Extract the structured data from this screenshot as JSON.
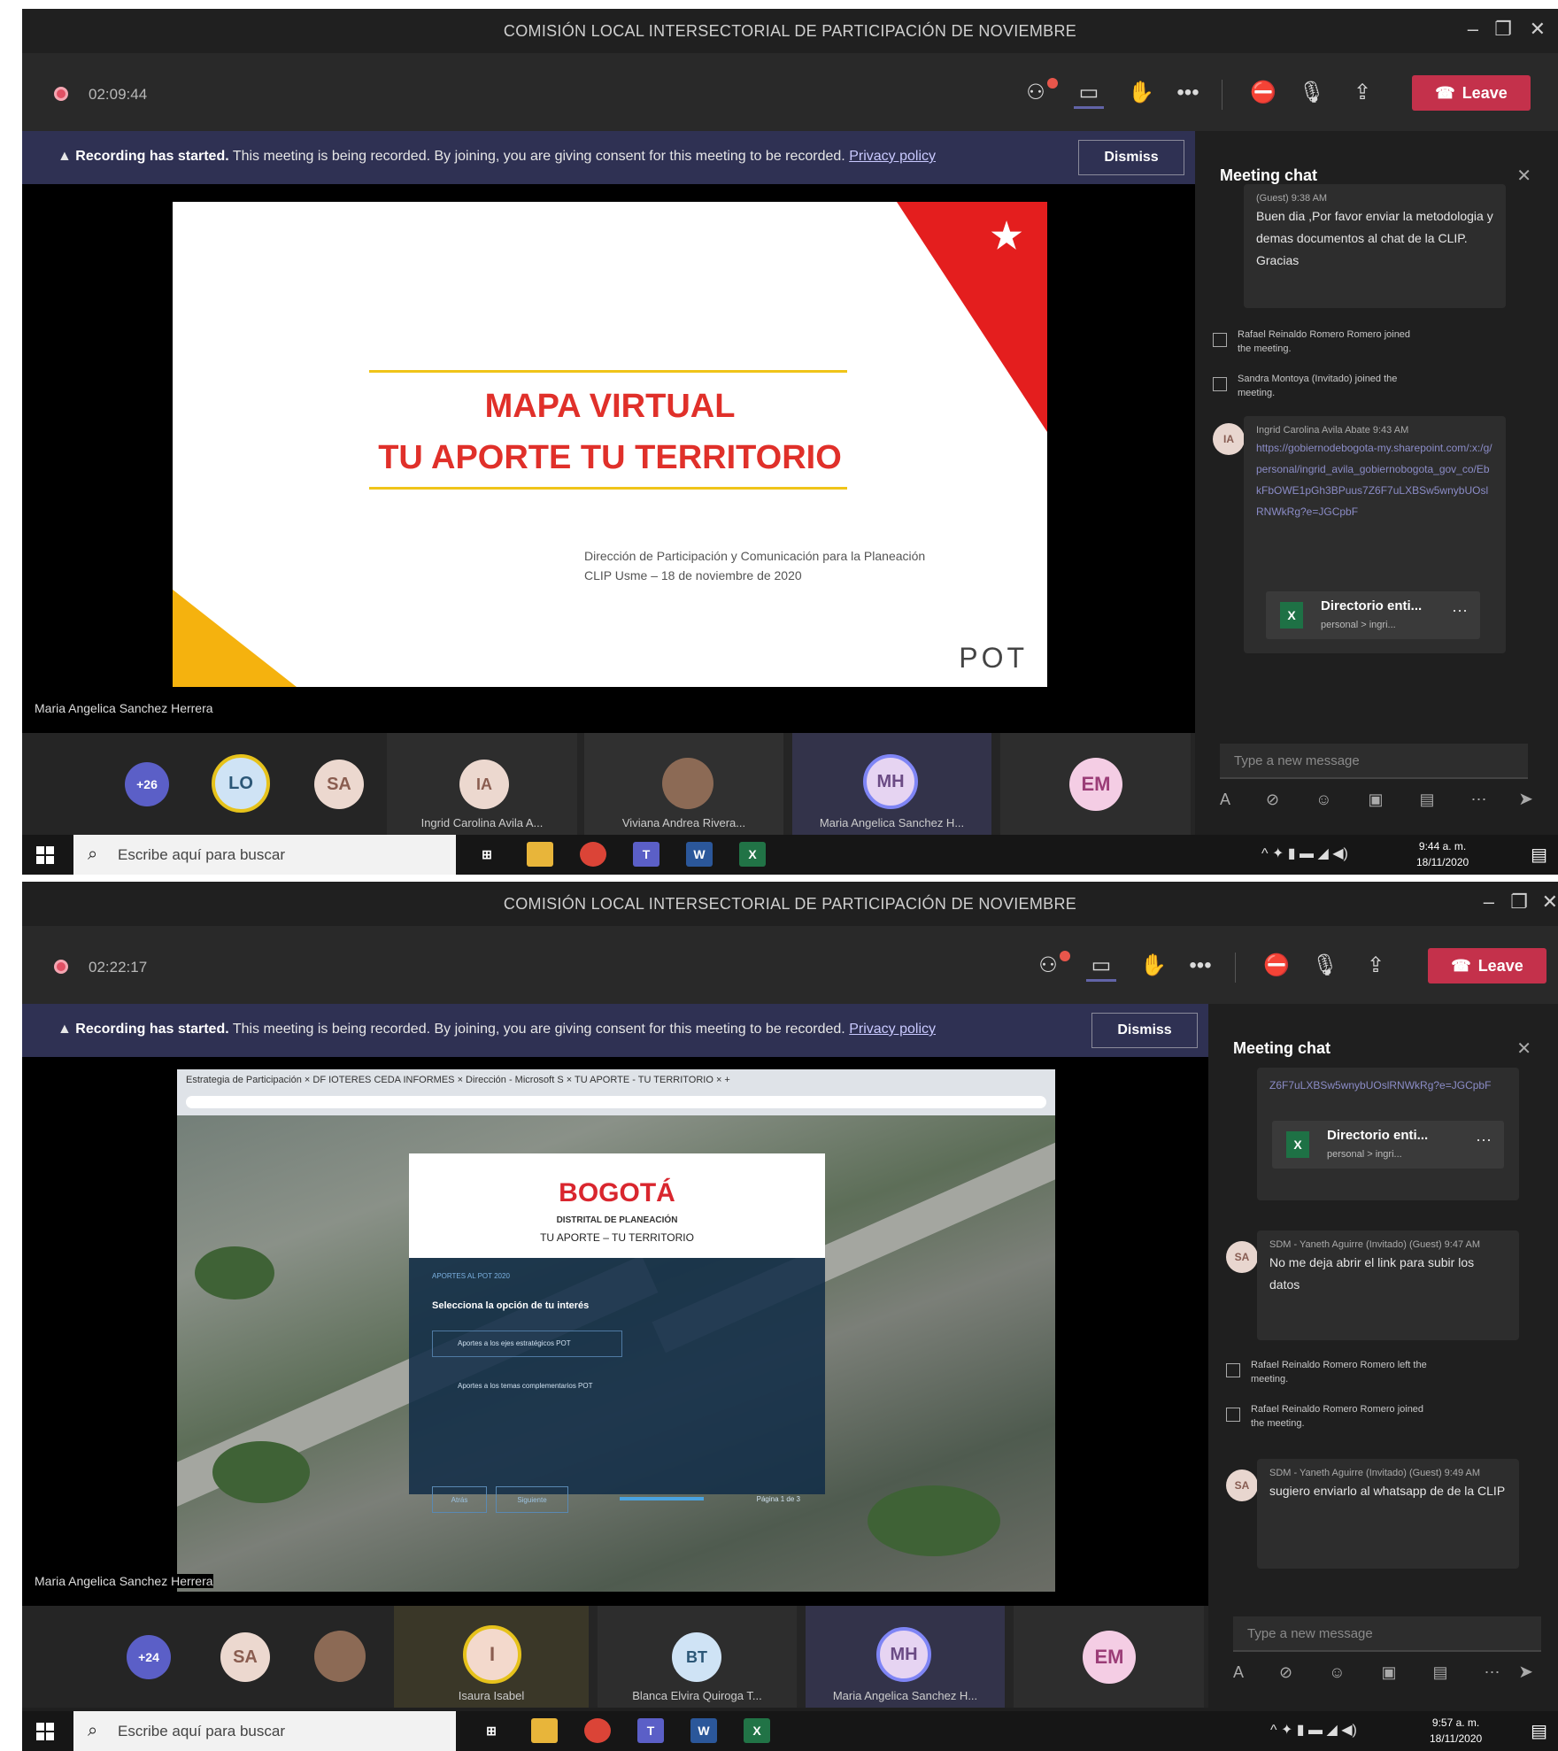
{
  "screens": [
    {
      "window_title": "COMISIÓN LOCAL INTERSECTORIAL DE PARTICIPACIÓN DE NOVIEMBRE",
      "timer": "02:09:44",
      "leave_label": "Leave",
      "banner": {
        "title": "Recording has started.",
        "text": "This meeting is being recorded. By joining, you are giving consent for this meeting to be recorded.",
        "link": "Privacy policy",
        "dismiss": "Dismiss"
      },
      "presenter": "Maria Angelica Sanchez Herrera",
      "slide": {
        "title1": "MAPA VIRTUAL",
        "title2": "TU APORTE TU TERRITORIO",
        "sub1": "Dirección de Participación y Comunicación para la Planeación",
        "sub2": "CLIP Usme – 18 de noviembre de 2020",
        "brand": "POT"
      },
      "participants": [
        {
          "initials": "+26",
          "name": ""
        },
        {
          "initials": "LO",
          "name": ""
        },
        {
          "initials": "SA",
          "name": ""
        },
        {
          "initials": "IA",
          "name": "Ingrid Carolina Avila A..."
        },
        {
          "initials": "",
          "name": "Viviana Andrea Rivera..."
        },
        {
          "initials": "MH",
          "name": "Maria Angelica Sanchez H..."
        },
        {
          "initials": "EM",
          "name": ""
        }
      ],
      "chat": {
        "header": "Meeting chat",
        "messages": [
          {
            "meta": "(Guest)  9:38 AM",
            "text": "Buen dia ,Por favor enviar la metodologia y demas documentos al chat de la CLIP. Gracias"
          },
          {
            "system": "Rafael Reinaldo Romero Romero joined the meeting."
          },
          {
            "system": "Sandra Montoya (Invitado) joined the meeting."
          },
          {
            "avatar": "IA",
            "meta": "Ingrid Carolina Avila Abate  9:43 AM",
            "link": "https://gobiernodebogota-my.sharepoint.com/:x:/g/personal/ingrid_avila_gobiernobogota_gov_co/EbkFbOWE1pGh3BPuus7Z6F7uLXBSw5wnybUOslRNWkRg?e=JGCpbF"
          }
        ],
        "file": {
          "name": "Directorio enti...",
          "path": "personal > ingri..."
        },
        "compose_placeholder": "Type a new message"
      },
      "taskbar": {
        "search": "Escribe aquí para buscar",
        "time": "9:44 a. m.",
        "date": "18/11/2020"
      }
    },
    {
      "window_title": "COMISIÓN LOCAL INTERSECTORIAL DE PARTICIPACIÓN DE NOVIEMBRE",
      "timer": "02:22:17",
      "leave_label": "Leave",
      "banner": {
        "title": "Recording has started.",
        "text": "This meeting is being recorded. By joining, you are giving consent for this meeting to be recorded.",
        "link": "Privacy policy",
        "dismiss": "Dismiss"
      },
      "presenter": "Maria Angelica Sanchez Herrera",
      "browser_tabs": "Estrategia de Participación  ×   DF IOTERES CEDA INFORMES  ×   Dirección - Microsoft S  ×   TU APORTE - TU TERRITORIO  ×  +",
      "dialog": {
        "logo": "BOGOTÁ",
        "sub": "DISTRITAL DE PLANEACIÓN",
        "tagline": "TU APORTE – TU TERRITORIO",
        "kicker": "APORTES AL POT 2020",
        "question": "Selecciona la opción de tu interés",
        "opt1": "Aportes a los ejes estratégicos POT",
        "opt2": "Aportes a los temas complementarios POT",
        "back": "Atrás",
        "next": "Siguiente",
        "page": "Página 1 de 3"
      },
      "participants": [
        {
          "initials": "+24",
          "name": ""
        },
        {
          "initials": "SA",
          "name": ""
        },
        {
          "initials": "",
          "name": ""
        },
        {
          "initials": "I",
          "name": "Isaura Isabel"
        },
        {
          "initials": "BT",
          "name": "Blanca Elvira Quiroga T..."
        },
        {
          "initials": "MH",
          "name": "Maria Angelica Sanchez H..."
        },
        {
          "initials": "EM",
          "name": ""
        }
      ],
      "chat": {
        "header": "Meeting chat",
        "top_link": "Z6F7uLXBSw5wnybUOslRNWkRg?e=JGCpbF",
        "file": {
          "name": "Directorio enti...",
          "path": "personal > ingri..."
        },
        "messages": [
          {
            "avatar": "SA",
            "meta": "SDM - Yaneth Aguirre (Invitado) (Guest)  9:47 AM",
            "text": "No me deja abrir el link para subir los datos"
          },
          {
            "system": "Rafael Reinaldo Romero Romero left the meeting."
          },
          {
            "system": "Rafael Reinaldo Romero Romero joined the meeting."
          },
          {
            "avatar": "SA",
            "meta": "SDM - Yaneth Aguirre (Invitado) (Guest)  9:49 AM",
            "text": "sugiero enviarlo al whatsapp de de la CLIP"
          }
        ],
        "compose_placeholder": "Type a new message"
      },
      "taskbar": {
        "search": "Escribe aquí para buscar",
        "time": "9:57 a. m.",
        "date": "18/11/2020"
      }
    }
  ],
  "colors": {
    "leave": "#c4314b",
    "banner": "#2f3153",
    "accent": "#6264a7",
    "slide_red": "#e41e1e",
    "slide_yellow": "#f5b20e"
  },
  "icons": [
    "record-icon",
    "participants-icon",
    "chat-icon",
    "raise-hand-icon",
    "more-icon",
    "camera-off-icon",
    "mic-off-icon",
    "share-icon",
    "phone-icon",
    "close-icon",
    "windows-icon",
    "search-icon"
  ]
}
